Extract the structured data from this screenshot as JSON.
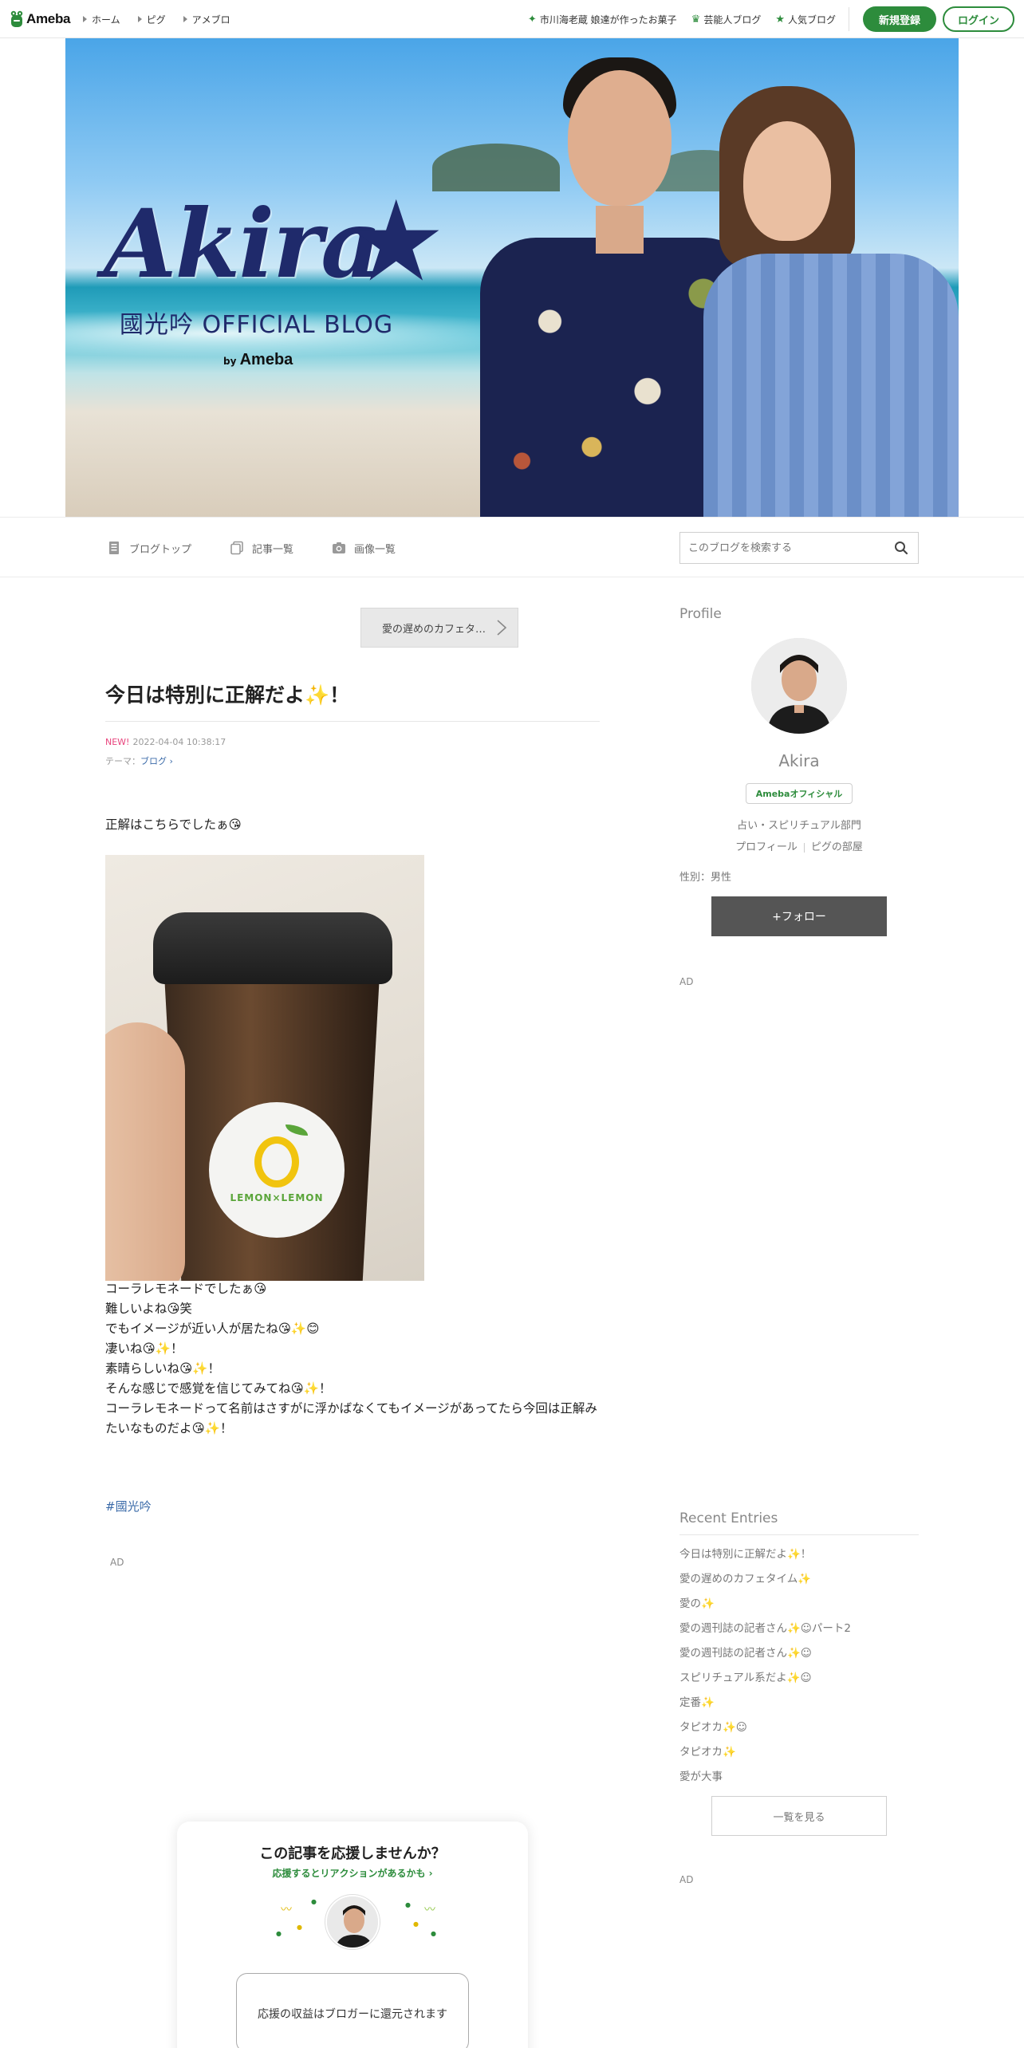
{
  "header": {
    "logo_text": "Ameba",
    "nav": [
      "ホーム",
      "ピグ",
      "アメブロ"
    ],
    "links": [
      {
        "icon": "sparkle-icon",
        "label": "市川海老蔵 娘達が作ったお菓子"
      },
      {
        "icon": "crown-icon",
        "label": "芸能人ブログ"
      },
      {
        "icon": "star-icon",
        "label": "人気ブログ"
      }
    ],
    "signup_label": "新規登録",
    "login_label": "ログイン"
  },
  "hero": {
    "title": "Akira",
    "star": "★",
    "subtitle": "國光吟 OFFICIAL BLOG",
    "by": "by",
    "brand": "Ameba"
  },
  "blog_nav": {
    "items": [
      "ブログトップ",
      "記事一覧",
      "画像一覧"
    ],
    "search_placeholder": "このブログを検索する"
  },
  "article": {
    "prev_entry_label": "愛の遅めのカフェタ…",
    "title": "今日は特別に正解だよ✨！",
    "new_badge": "NEW!",
    "datetime": "2022-04-04 10:38:17",
    "theme_label": "テーマ：",
    "theme_value": "ブログ",
    "intro": "正解はこちらでしたぁ😘",
    "photo_logo_text": "LEMON×LEMON",
    "lines": [
      "コーラレモネードでしたぁ😘",
      "難しいよね😘笑",
      "でもイメージが近い人が居たね😘✨😊",
      "凄いね😘✨！",
      "素晴らしいね😘✨！",
      "そんな感じで感覚を信じてみてね😘✨！",
      "コーラレモネードって名前はさすがに浮かばなくてもイメージがあってたら今回は正解みたいなものだよ😘✨！"
    ],
    "hashtag": "#國光吟",
    "ad_label": "AD"
  },
  "support": {
    "heading": "この記事を応援しませんか？",
    "subtext": "応援するとリアクションがあるかも ›",
    "box_text": "応援の収益はブロガーに還元されます"
  },
  "sidebar": {
    "profile_title": "Profile",
    "name": "Akira",
    "badge": "Amebaオフィシャル",
    "category": "占い・スピリチュアル部門",
    "link_profile": "プロフィール",
    "link_pig": "ピグの部屋",
    "gender": "性別：男性",
    "follow_label": "+フォロー",
    "ad_label": "AD",
    "recent_title": "Recent Entries",
    "recent_entries": [
      "今日は特別に正解だよ✨！",
      "愛の遅めのカフェタイム✨",
      "愛の✨",
      "愛の週刊誌の記者さん✨☺パート2",
      "愛の週刊誌の記者さん✨☺",
      "スピリチュアル系だよ✨☺",
      "定番✨",
      "タピオカ✨☺",
      "タピオカ✨",
      "愛が大事"
    ],
    "more_label": "一覧を見る",
    "ad_label_2": "AD"
  },
  "colors": {
    "brand_green": "#2d8c3c",
    "link_blue": "#3a6aa8",
    "new_pink": "#e8437c",
    "follow_bg": "#555555"
  }
}
